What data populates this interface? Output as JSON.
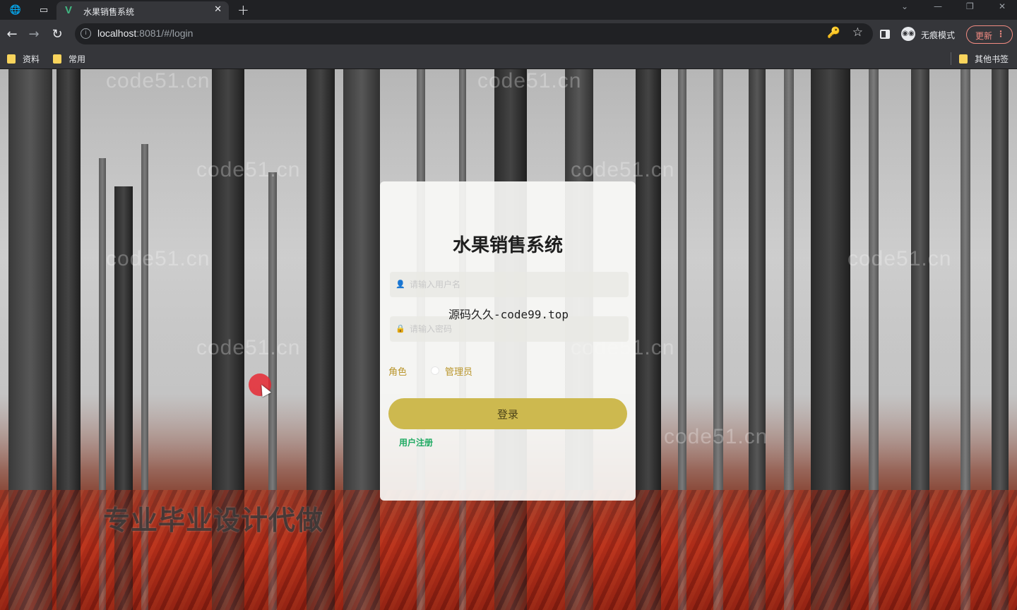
{
  "browser": {
    "tab_title": "水果销售系统",
    "url_host": "localhost",
    "url_rest": ":8081/#/login",
    "incognito_label": "无痕模式",
    "update_label": "更新",
    "bookmarks": [
      "资料",
      "常用"
    ],
    "other_bookmarks": "其他书签"
  },
  "login": {
    "title": "水果销售系统",
    "username_placeholder": "请输入用户名",
    "password_placeholder": "请输入密码",
    "role_label": "角色",
    "role_option": "管理员",
    "login_button": "登录",
    "register_link": "用户注册"
  },
  "overlays": {
    "source_watermark": "源码久久-code99.top",
    "site_watermark": "code51.cn",
    "ad_text": "专业毕业设计代做"
  },
  "colors": {
    "accent_gold": "#cdb94f",
    "link_green": "#1eaa62",
    "role_text": "#b9952a"
  }
}
